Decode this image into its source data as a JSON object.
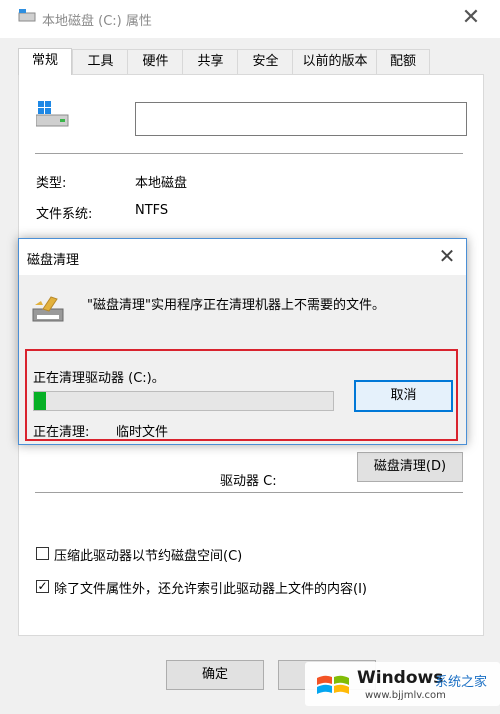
{
  "outer": {
    "title": "本地磁盘 (C:) 属性",
    "close_glyph": "✕",
    "tabs": [
      "常规",
      "工具",
      "硬件",
      "共享",
      "安全",
      "以前的版本",
      "配额"
    ],
    "name_value": "",
    "type_label": "类型:",
    "type_value": "本地磁盘",
    "fs_label": "文件系统:",
    "fs_value": "NTFS",
    "drive_caption": "驱动器 C:",
    "cleanup_button": "磁盘清理(D)",
    "compress_label": "压缩此驱动器以节约磁盘空间(C)",
    "compress_checked": false,
    "index_label": "除了文件属性外，还允许索引此驱动器上文件的内容(I)",
    "index_checked": true,
    "ok_button": "确定"
  },
  "dialog": {
    "title": "磁盘清理",
    "close_glyph": "✕",
    "message": "\"磁盘清理\"实用程序正在清理机器上不需要的文件。",
    "status": "正在清理驱动器  (C:)。",
    "progress_fraction": 0.04,
    "cleaning_label": "正在清理:",
    "cleaning_value": "临时文件",
    "cancel_button": "取消"
  },
  "watermark": {
    "brand": "Windows",
    "suffix": "系统之家",
    "url": "www.bjjmlv.com"
  },
  "colors": {
    "progress": "#06b025",
    "highlight": "#d9232e",
    "focus": "#0078d7"
  }
}
